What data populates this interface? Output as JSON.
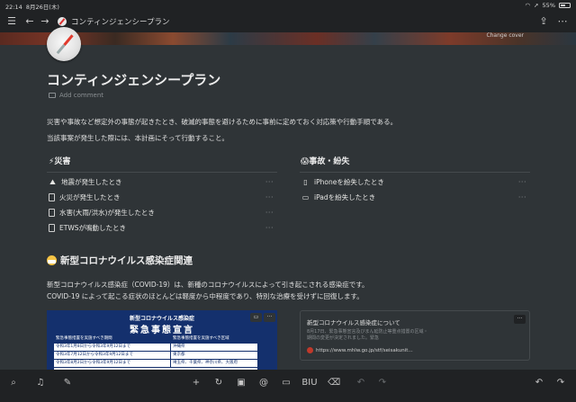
{
  "status": {
    "time": "22:14",
    "date": "8月26日(木)",
    "battery": "55%",
    "battery_level": 0.55
  },
  "topbar": {
    "menu_icon": "hamburger-icon",
    "back_icon": "arrow-left-icon",
    "forward_icon": "arrow-right-icon",
    "breadcrumb": "コンティンジェンシープラン",
    "share_icon": "share-icon",
    "more_icon": "more-icon"
  },
  "cover": {
    "change_label": "Change cover"
  },
  "page": {
    "title": "コンティンジェンシープラン",
    "add_comment": "Add comment",
    "intro_1": "災害や事故など想定外の事態が起きたとき、破滅的事態を避けるために事前に定めておく対応策や行動手順である。",
    "intro_2": "当該事案が発生した際には、本計画にそって行動すること。"
  },
  "disaster": {
    "heading": "⚡災害",
    "items": [
      {
        "label": "地震が発生したとき",
        "icon": "earthquake-icon"
      },
      {
        "label": "火災が発生したとき",
        "icon": "page-icon"
      },
      {
        "label": "水害(大雨/洪水)が発生したとき",
        "icon": "page-icon"
      },
      {
        "label": "ETWSが鳴動したとき",
        "icon": "page-icon"
      }
    ]
  },
  "accident": {
    "heading": "😱事故・紛失",
    "items": [
      {
        "label": "iPhoneを紛失したとき",
        "icon": "phone-icon"
      },
      {
        "label": "iPadを紛失したとき",
        "icon": "tablet-icon"
      }
    ]
  },
  "covid": {
    "heading": "新型コロナウイルス感染症関連",
    "para_1": "新型コロナウイルス感染症（COVID-19）は、新種のコロナウイルスによって引き起こされる感染症です。",
    "para_2": "COVID-19 によって起こる症状のほとんどは軽度から中程度であり、特別な治療を受けずに回復します。",
    "image": {
      "sup_title": "新型コロナウイルス感染症",
      "title": "緊急事態宣言",
      "table_header": [
        "緊急事態措置を実施すべき期間",
        "緊急事態措置を実施すべき区域"
      ],
      "rows": [
        [
          "令和3年1月8日から令和3年9月12日まで",
          "沖縄県"
        ],
        [
          "令和3年7月12日から令和3年9月12日まで",
          "東京都"
        ],
        [
          "令和3年8月2日から令和3年9月12日まで",
          "埼玉県、千葉県、神奈川県、大阪府"
        ]
      ]
    },
    "bookmark": {
      "title": "新型コロナウイルス感染症について",
      "desc": "8月17日、緊急事態宣言及びまん延防止等重点措置の区域・期間の変更が決定されました。緊急",
      "url": "https://www.mhlw.go.jp/stf/seisakunit..."
    }
  },
  "toolbar": {
    "left": [
      "search-icon",
      "bell-icon",
      "compose-icon"
    ],
    "center": [
      "plus-icon",
      "turn-into-icon",
      "image-icon",
      "mention-icon",
      "comment-icon",
      "text-style-icon",
      "trash-icon",
      "undo-icon",
      "redo-icon"
    ],
    "text_style_label": "BIU"
  }
}
